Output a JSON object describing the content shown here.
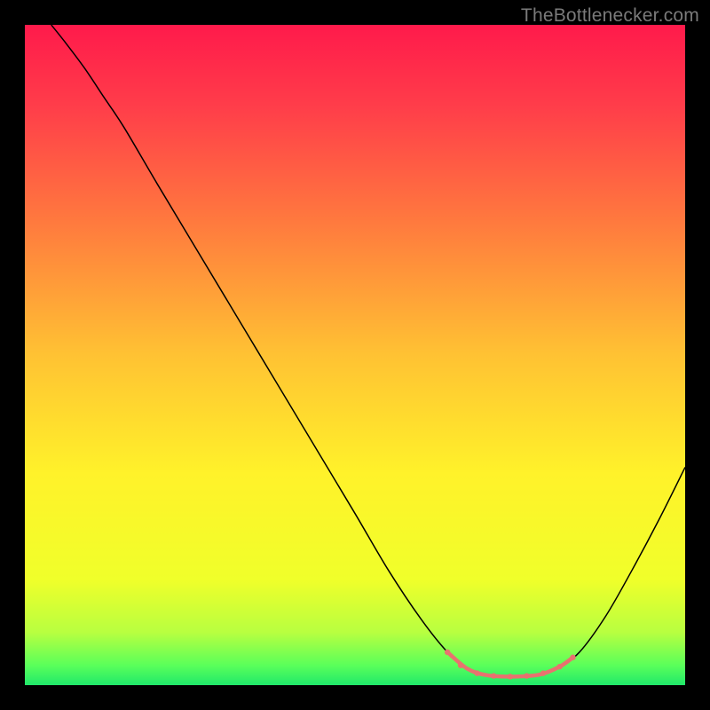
{
  "watermark": "TheBottlenecker.com",
  "chart_data": {
    "type": "line",
    "title": "",
    "xlabel": "",
    "ylabel": "",
    "xlim": [
      0,
      100
    ],
    "ylim": [
      0,
      100
    ],
    "gradient_stops": [
      {
        "offset": 0,
        "color": "#ff1a4b"
      },
      {
        "offset": 12,
        "color": "#ff3c4a"
      },
      {
        "offset": 30,
        "color": "#ff7a3e"
      },
      {
        "offset": 50,
        "color": "#ffc233"
      },
      {
        "offset": 68,
        "color": "#fff22a"
      },
      {
        "offset": 84,
        "color": "#f0ff2a"
      },
      {
        "offset": 92,
        "color": "#b8ff40"
      },
      {
        "offset": 97,
        "color": "#5aff5a"
      },
      {
        "offset": 100,
        "color": "#20e86a"
      }
    ],
    "series": [
      {
        "name": "curve",
        "stroke": "#000000",
        "stroke_width": 1.5,
        "points": [
          {
            "x": 4.0,
            "y": 100.0
          },
          {
            "x": 6.0,
            "y": 97.5
          },
          {
            "x": 9.0,
            "y": 93.5
          },
          {
            "x": 12.0,
            "y": 89.0
          },
          {
            "x": 15.0,
            "y": 84.5
          },
          {
            "x": 20.0,
            "y": 76.0
          },
          {
            "x": 26.0,
            "y": 66.0
          },
          {
            "x": 32.0,
            "y": 56.0
          },
          {
            "x": 38.0,
            "y": 46.0
          },
          {
            "x": 44.0,
            "y": 36.0
          },
          {
            "x": 50.0,
            "y": 26.0
          },
          {
            "x": 55.0,
            "y": 17.5
          },
          {
            "x": 60.0,
            "y": 10.0
          },
          {
            "x": 64.0,
            "y": 5.0
          },
          {
            "x": 67.0,
            "y": 2.5
          },
          {
            "x": 70.0,
            "y": 1.5
          },
          {
            "x": 74.0,
            "y": 1.3
          },
          {
            "x": 78.0,
            "y": 1.6
          },
          {
            "x": 81.0,
            "y": 2.8
          },
          {
            "x": 84.0,
            "y": 5.0
          },
          {
            "x": 88.0,
            "y": 10.5
          },
          {
            "x": 92.0,
            "y": 17.5
          },
          {
            "x": 96.0,
            "y": 25.0
          },
          {
            "x": 100.0,
            "y": 33.0
          }
        ]
      },
      {
        "name": "highlight",
        "stroke": "#e8726f",
        "stroke_width": 4.5,
        "points": [
          {
            "x": 64.0,
            "y": 5.0
          },
          {
            "x": 67.0,
            "y": 2.5
          },
          {
            "x": 70.0,
            "y": 1.5
          },
          {
            "x": 74.0,
            "y": 1.3
          },
          {
            "x": 78.0,
            "y": 1.6
          },
          {
            "x": 81.0,
            "y": 2.8
          },
          {
            "x": 83.0,
            "y": 4.2
          }
        ]
      }
    ],
    "highlight_markers": [
      {
        "x": 64.0,
        "y": 5.0
      },
      {
        "x": 66.0,
        "y": 3.0
      },
      {
        "x": 68.5,
        "y": 1.8
      },
      {
        "x": 71.0,
        "y": 1.4
      },
      {
        "x": 73.5,
        "y": 1.3
      },
      {
        "x": 76.0,
        "y": 1.4
      },
      {
        "x": 78.5,
        "y": 1.8
      },
      {
        "x": 81.0,
        "y": 2.8
      },
      {
        "x": 83.0,
        "y": 4.2
      }
    ]
  }
}
